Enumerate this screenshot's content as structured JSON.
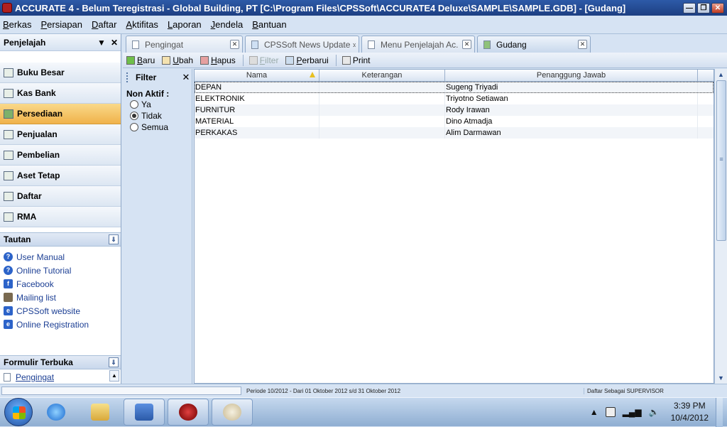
{
  "window": {
    "title": "ACCURATE 4  -  Belum Teregistrasi - Global Building, PT   [C:\\Program Files\\CPSSoft\\ACCURATE4 Deluxe\\SAMPLE\\SAMPLE.GDB] - [Gudang]"
  },
  "menubar": {
    "items": [
      "Berkas",
      "Persiapan",
      "Daftar",
      "Aktifitas",
      "Laporan",
      "Jendela",
      "Bantuan"
    ]
  },
  "explorer": {
    "title": "Penjelajah",
    "nav": [
      "Buku Besar",
      "Kas Bank",
      "Persediaan",
      "Penjualan",
      "Pembelian",
      "Aset Tetap",
      "Daftar",
      "RMA"
    ],
    "active_nav": "Persediaan",
    "links_title": "Tautan",
    "links": [
      "User Manual",
      "Online Tutorial",
      "Facebook",
      "Mailing list",
      "CPSSoft website",
      "Online Registration"
    ],
    "forms_title": "Formulir Terbuka",
    "forms": [
      "Pengingat"
    ]
  },
  "tabs": [
    {
      "label": "Pengingat",
      "active": false
    },
    {
      "label": "CPSSoft News Update » ...",
      "active": false
    },
    {
      "label": "Menu Penjelajah Ac...",
      "active": false
    },
    {
      "label": "Gudang",
      "active": true
    }
  ],
  "toolbar": {
    "baru": "Baru",
    "ubah": "Ubah",
    "hapus": "Hapus",
    "filter": "Filter",
    "perbarui": "Perbarui",
    "print": "Print"
  },
  "filter": {
    "title": "Filter",
    "group_label": "Non Aktif :",
    "options": [
      "Ya",
      "Tidak",
      "Semua"
    ],
    "selected": "Tidak"
  },
  "grid": {
    "columns": [
      "Nama",
      "Keterangan",
      "Penanggung Jawab"
    ],
    "rows": [
      [
        "DEPAN",
        "",
        "Sugeng Triyadi"
      ],
      [
        "ELEKTRONIK",
        "",
        "Triyotno Setiawan"
      ],
      [
        "FURNITUR",
        "",
        "Rody Irawan"
      ],
      [
        "MATERIAL",
        "",
        "Dino Atmadja"
      ],
      [
        "PERKAKAS",
        "",
        "Alim Darmawan"
      ]
    ]
  },
  "statusbar": {
    "period": "Periode 10/2012 - Dari 01 Oktober 2012 s/d 31 Oktober 2012",
    "user": "Daftar Sebagai SUPERVISOR"
  },
  "taskbar": {
    "time": "3:39 PM",
    "date": "10/4/2012"
  }
}
